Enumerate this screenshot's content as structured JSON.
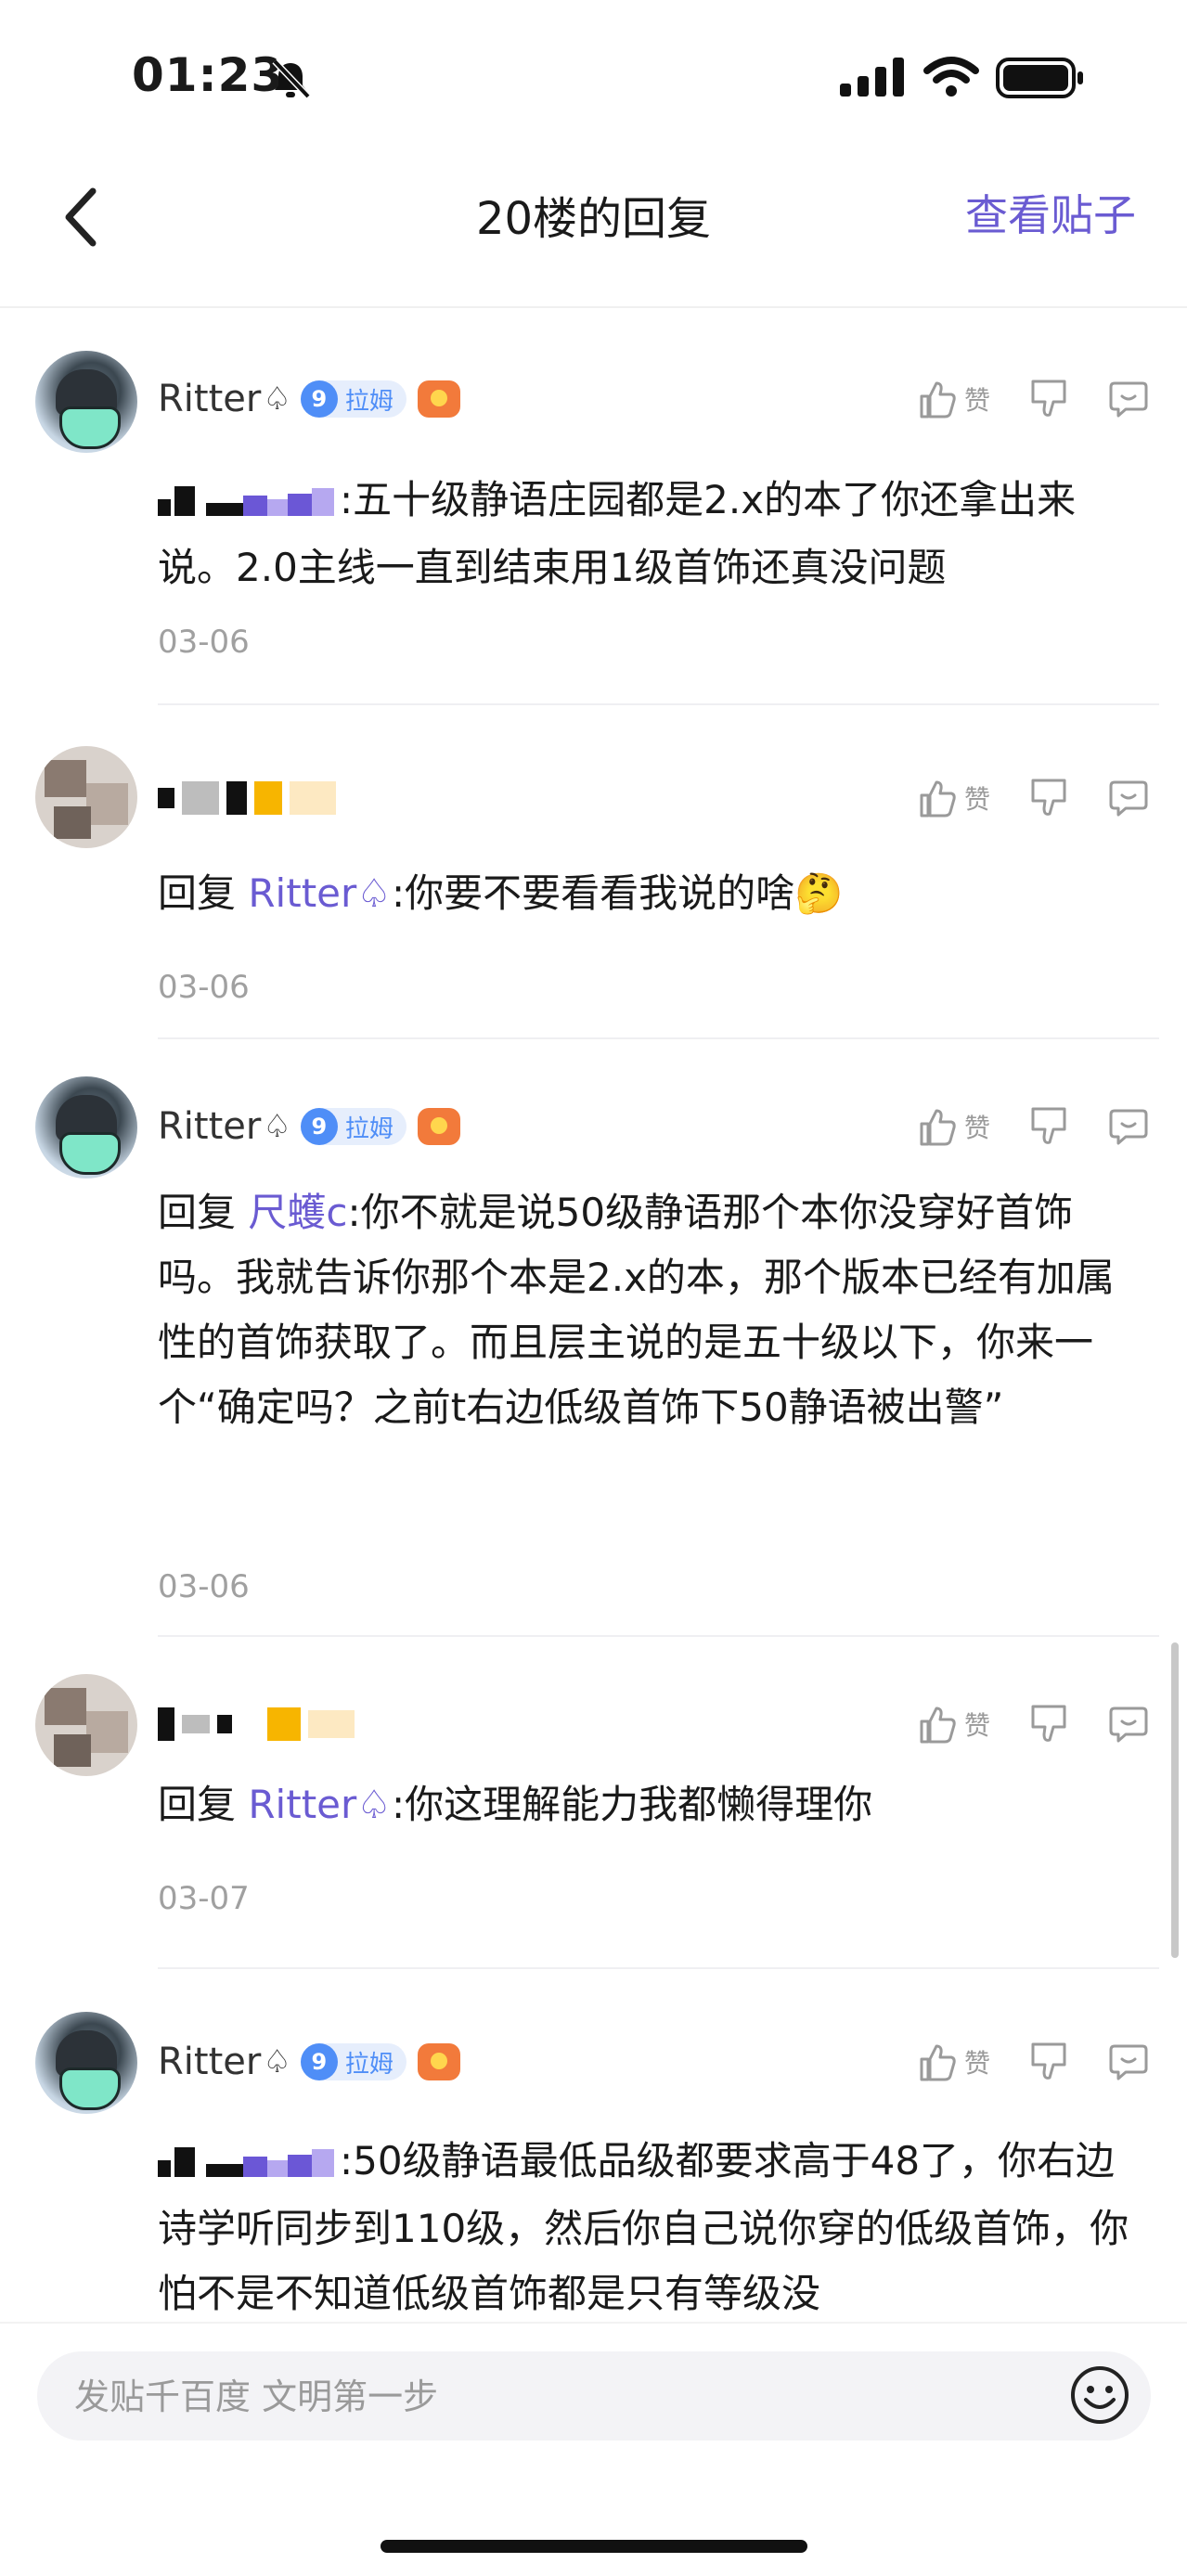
{
  "status": {
    "time": "01:23"
  },
  "nav": {
    "title": "20楼的回复",
    "action": "查看贴子"
  },
  "actions": {
    "like": "赞"
  },
  "comments": [
    {
      "author": "Ritter",
      "level": "9",
      "level_name": "拉姆",
      "text": ":五十级静语庄园都是2.x的本了你还拿出来说。2.0主线一直到结束用1级首饰还真没问题",
      "date": "03-06"
    },
    {
      "reply_prefix": "回复",
      "reply_to": "Ritter",
      "text": ":你要不要看看我说的啥🤔",
      "date": "03-06"
    },
    {
      "author": "Ritter",
      "level": "9",
      "level_name": "拉姆",
      "reply_prefix": "回复",
      "reply_to": "尺蠖c",
      "text": ":你不就是说50级静语那个本你没穿好首饰吗。我就告诉你那个本是2.x的本，那个版本已经有加属性的首饰获取了。而且层主说的是五十级以下，你来一个“确定吗？之前t右边低级首饰下50静语被出警”",
      "date": "03-06"
    },
    {
      "reply_prefix": "回复",
      "reply_to": "Ritter",
      "text": ":你这理解能力我都懒得理你",
      "date": "03-07"
    },
    {
      "author": "Ritter",
      "level": "9",
      "level_name": "拉姆",
      "text": ":50级静语最低品级都要求高于48了，你右边诗学听同步到110级，然后你自己说你穿的低级首饰，你怕不是不知道低级首饰都是只有等级没"
    }
  ],
  "composer": {
    "placeholder": "发贴千百度 文明第一步"
  }
}
